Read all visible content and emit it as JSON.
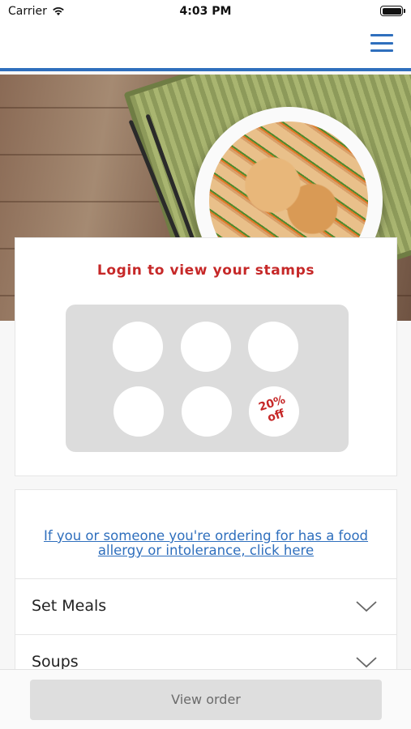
{
  "status_bar": {
    "carrier": "Carrier",
    "time": "4:03 PM"
  },
  "header": {
    "menu_icon": "hamburger-menu-icon",
    "accent_color": "#2f6fbd"
  },
  "stamp_card": {
    "title": "Login to view your stamps",
    "stamps": [
      "",
      "",
      "",
      "",
      ""
    ],
    "reward": {
      "line1": "20%",
      "line2": "off"
    },
    "title_color": "#c62828"
  },
  "allergy": {
    "link_text": "If you or someone you're ordering for has a food allergy or intolerance, click here"
  },
  "menu_categories": [
    {
      "label": "Set Meals",
      "icon": "chevron-down-icon"
    },
    {
      "label": "Soups",
      "icon": "chevron-down-icon"
    }
  ],
  "footer": {
    "view_order_label": "View order"
  }
}
